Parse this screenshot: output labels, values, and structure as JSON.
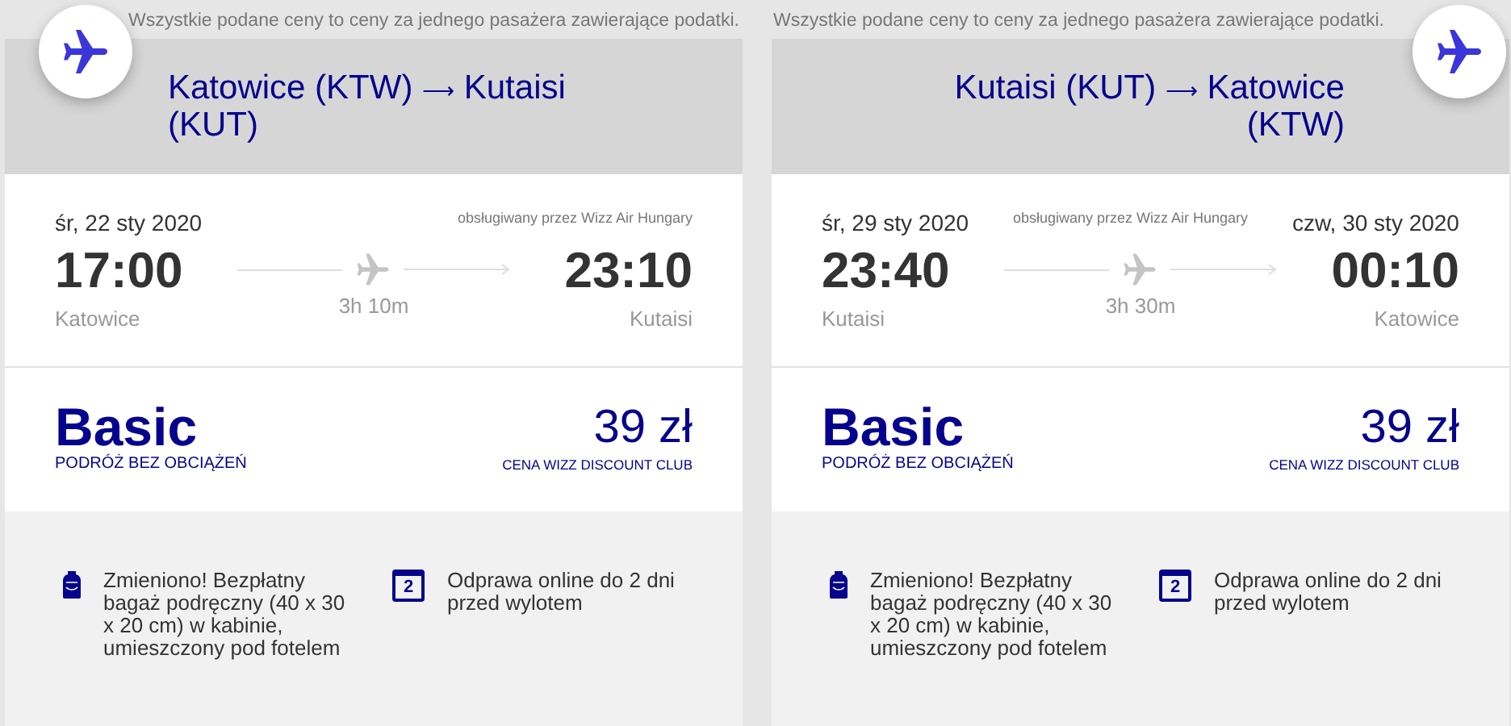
{
  "flights": [
    {
      "note": "Wszystkie podane ceny to ceny za jednego pasażera zawierające podatki.",
      "title_from": "Katowice (KTW)",
      "title_arrow": "⟶",
      "title_to": "Kutaisi (KUT)",
      "departure_date": "śr, 22 sty 2020",
      "operator": "obsługiwany przez Wizz Air Hungary",
      "departure_time": "17:00",
      "departure_city": "Katowice",
      "duration": "3h 10m",
      "arrival_time": "23:10",
      "arrival_city": "Kutaisi",
      "fare_name": "Basic",
      "fare_subtitle": "PODRÓŻ BEZ OBCIĄŻEŃ",
      "price": "39 zł",
      "price_label": "CENA WIZZ DISCOUNT CLUB",
      "features": [
        {
          "kind": "bag",
          "text": "Zmieniono! Bezpłatny bagaż podręczny (40 x 30 x 20 cm) w kabinie, umieszczony pod fotelem"
        },
        {
          "kind": "calendar",
          "icon_text": "2",
          "text": "Odprawa online do 2 dni przed wylotem"
        }
      ]
    },
    {
      "note": "Wszystkie podane ceny to ceny za jednego pasażera zawierające podatki.",
      "title_from": "Kutaisi (KUT)",
      "title_arrow": "⟶",
      "title_to": "Katowice (KTW)",
      "departure_date": "śr, 29 sty 2020",
      "operator": "obsługiwany przez Wizz Air Hungary",
      "arrival_date": "czw, 30 sty 2020",
      "departure_time": "23:40",
      "departure_city": "Kutaisi",
      "duration": "3h 30m",
      "arrival_time": "00:10",
      "arrival_city": "Katowice",
      "fare_name": "Basic",
      "fare_subtitle": "PODRÓŻ BEZ OBCIĄŻEŃ",
      "price": "39 zł",
      "price_label": "CENA WIZZ DISCOUNT CLUB",
      "features": [
        {
          "kind": "bag",
          "text": "Zmieniono! Bezpłatny bagaż podręczny (40 x 30 x 20 cm) w kabinie, umieszczony pod fotelem"
        },
        {
          "kind": "calendar",
          "icon_text": "2",
          "text": "Odprawa online do 2 dni przed wylotem"
        }
      ]
    }
  ]
}
